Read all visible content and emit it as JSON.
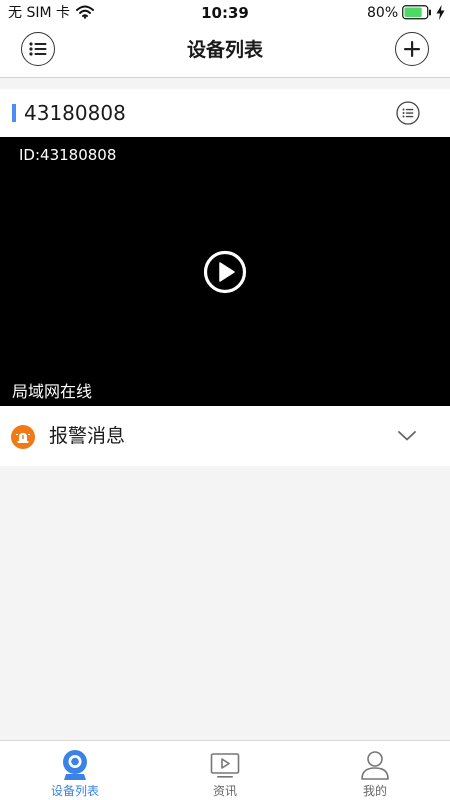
{
  "status_bar": {
    "carrier": "无 SIM 卡",
    "time": "10:39",
    "battery": "80%",
    "battery_fill": 0.8
  },
  "nav": {
    "title": "设备列表",
    "menu_icon": "list-icon",
    "add_icon": "plus-icon"
  },
  "device": {
    "name": "43180808",
    "video_id": "ID:43180808",
    "status": "局域网在线",
    "accent_color": "#4a8ef5"
  },
  "alarm": {
    "label": "报警消息",
    "icon_color": "#f07a16"
  },
  "tabs": [
    {
      "label": "设备列表",
      "icon": "camera-icon",
      "active": true
    },
    {
      "label": "资讯",
      "icon": "video-play-icon",
      "active": false
    },
    {
      "label": "我的",
      "icon": "user-icon",
      "active": false
    }
  ],
  "colors": {
    "accent": "#3b82e6",
    "battery_green": "#4cd964"
  }
}
